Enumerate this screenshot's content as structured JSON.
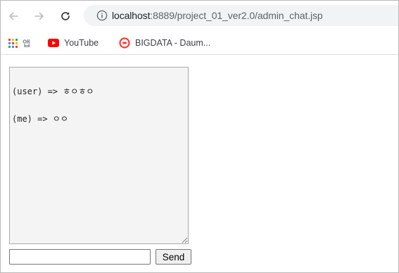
{
  "browser": {
    "url_host": "localhost",
    "url_path": ":8889/project_01_ver2.0/admin_chat.jsp"
  },
  "bookmarks": {
    "apps_label": "앱",
    "items": [
      {
        "label": "YouTube",
        "icon": "youtube-icon"
      },
      {
        "label": "BIGDATA - Daum...",
        "icon": "daum-icon"
      }
    ]
  },
  "chat": {
    "lines": [
      "(user) => ㅎㅇㅎㅇ",
      "(me) => ㅇㅇ"
    ],
    "input_value": "",
    "send_label": "Send"
  },
  "colors": {
    "youtube_red": "#ff0000",
    "daum_red": "#ff3b30",
    "icon_gray": "#5f6368"
  }
}
